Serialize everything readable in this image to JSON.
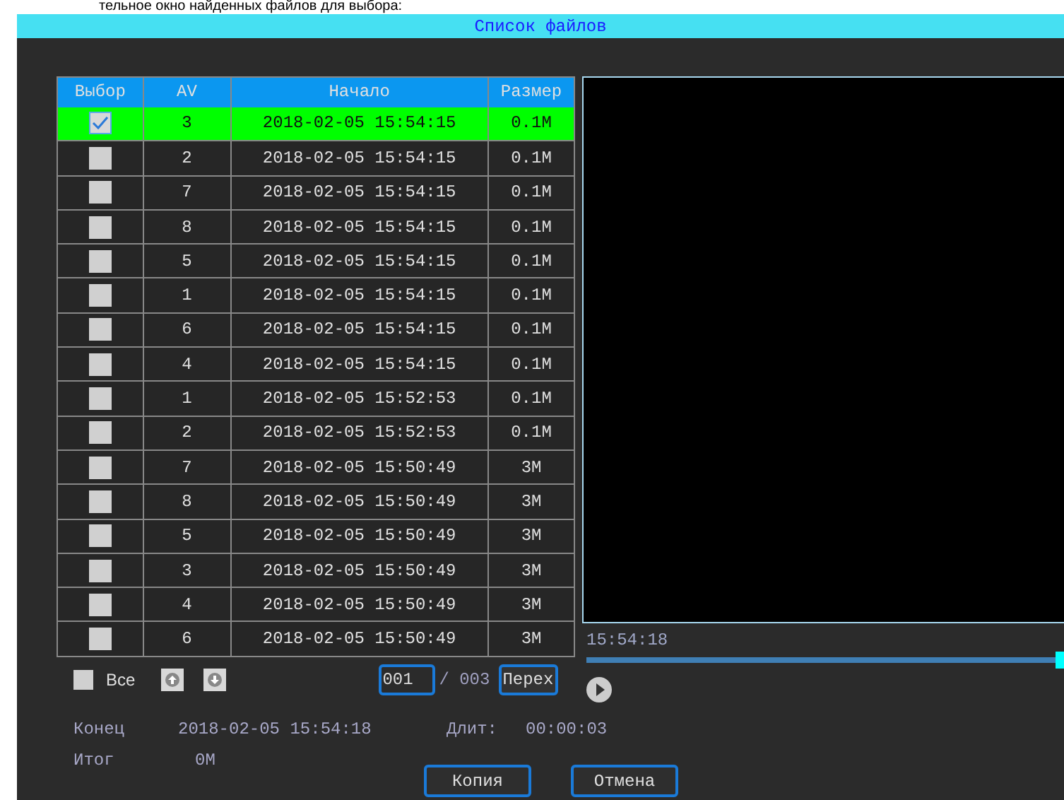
{
  "page_caption": "тельное окно найденных файлов для выбора:",
  "window": {
    "title": "Список файлов"
  },
  "table": {
    "columns": [
      "Выбор",
      "AV",
      "Начало",
      "Размер"
    ],
    "rows": [
      {
        "checked": true,
        "selected": true,
        "av": "3",
        "start": "2018-02-05 15:54:15",
        "size": "0.1M"
      },
      {
        "checked": false,
        "selected": false,
        "av": "2",
        "start": "2018-02-05 15:54:15",
        "size": "0.1M"
      },
      {
        "checked": false,
        "selected": false,
        "av": "7",
        "start": "2018-02-05 15:54:15",
        "size": "0.1M"
      },
      {
        "checked": false,
        "selected": false,
        "av": "8",
        "start": "2018-02-05 15:54:15",
        "size": "0.1M"
      },
      {
        "checked": false,
        "selected": false,
        "av": "5",
        "start": "2018-02-05 15:54:15",
        "size": "0.1M"
      },
      {
        "checked": false,
        "selected": false,
        "av": "1",
        "start": "2018-02-05 15:54:15",
        "size": "0.1M"
      },
      {
        "checked": false,
        "selected": false,
        "av": "6",
        "start": "2018-02-05 15:54:15",
        "size": "0.1M"
      },
      {
        "checked": false,
        "selected": false,
        "av": "4",
        "start": "2018-02-05 15:54:15",
        "size": "0.1M"
      },
      {
        "checked": false,
        "selected": false,
        "av": "1",
        "start": "2018-02-05 15:52:53",
        "size": "0.1M"
      },
      {
        "checked": false,
        "selected": false,
        "av": "2",
        "start": "2018-02-05 15:52:53",
        "size": "0.1M"
      },
      {
        "checked": false,
        "selected": false,
        "av": "7",
        "start": "2018-02-05 15:50:49",
        "size": "3M"
      },
      {
        "checked": false,
        "selected": false,
        "av": "8",
        "start": "2018-02-05 15:50:49",
        "size": "3M"
      },
      {
        "checked": false,
        "selected": false,
        "av": "5",
        "start": "2018-02-05 15:50:49",
        "size": "3M"
      },
      {
        "checked": false,
        "selected": false,
        "av": "3",
        "start": "2018-02-05 15:50:49",
        "size": "3M"
      },
      {
        "checked": false,
        "selected": false,
        "av": "4",
        "start": "2018-02-05 15:50:49",
        "size": "3M"
      },
      {
        "checked": false,
        "selected": false,
        "av": "6",
        "start": "2018-02-05 15:50:49",
        "size": "3M"
      }
    ]
  },
  "select_all": {
    "label": "Все",
    "checked": false
  },
  "pager": {
    "page": "001",
    "total": "/ 003",
    "go_button": "Перех"
  },
  "player": {
    "time": "15:54:18",
    "level": 1.0
  },
  "info": {
    "end_label": "Конец",
    "end_value": "2018-02-05 15:54:18",
    "duration_label": "Длит:",
    "duration_value": "00:00:03",
    "total_label": "Итог",
    "total_value": "0M"
  },
  "buttons": [
    "Копия",
    "Отмена"
  ]
}
